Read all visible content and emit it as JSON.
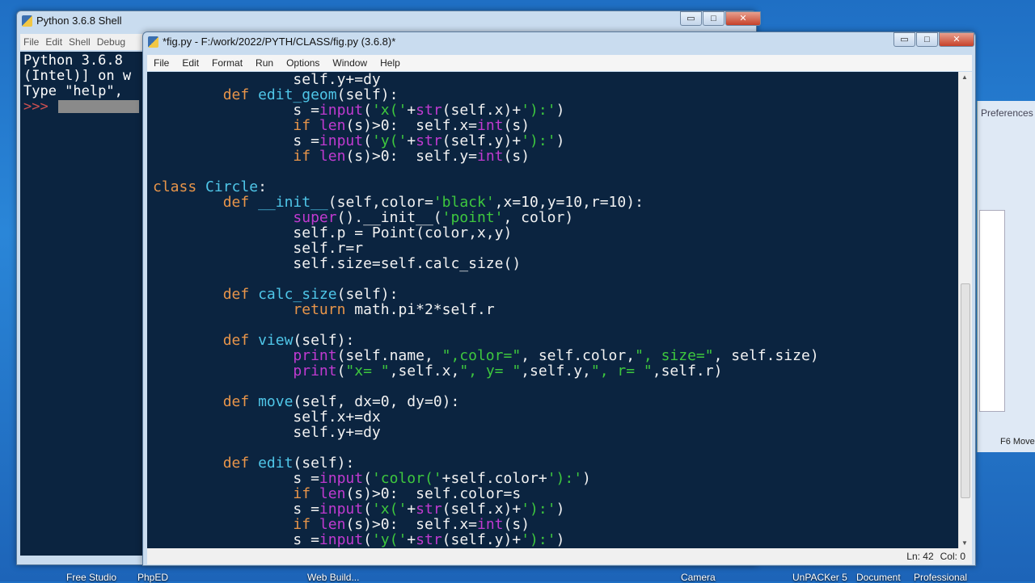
{
  "shell": {
    "title": "Python 3.6.8 Shell",
    "menu": [
      "File",
      "Edit",
      "Shell",
      "Debug"
    ],
    "lines": [
      "Python 3.6.8",
      "(Intel)] on w",
      "Type \"help\", "
    ],
    "prompt": ">>>"
  },
  "editor": {
    "title": "*fig.py - F:/work/2022/PYTH/CLASS/fig.py (3.6.8)*",
    "menu": [
      "File",
      "Edit",
      "Format",
      "Run",
      "Options",
      "Window",
      "Help"
    ],
    "status": {
      "line": "Ln: 42",
      "col": "Col: 0"
    },
    "code": [
      [
        [
          "",
          "                self.y+=dy"
        ]
      ],
      [
        [
          "",
          "        "
        ],
        [
          "k",
          "def"
        ],
        [
          "",
          " "
        ],
        [
          "d",
          "edit_geom"
        ],
        [
          "",
          "(self):"
        ]
      ],
      [
        [
          "",
          "                s ="
        ],
        [
          "b",
          "input"
        ],
        [
          "",
          "("
        ],
        [
          "s",
          "'x('"
        ],
        [
          "",
          "+"
        ],
        [
          "b",
          "str"
        ],
        [
          "",
          "(self.x)+"
        ],
        [
          "s",
          "'):'"
        ],
        [
          "",
          ")"
        ]
      ],
      [
        [
          "",
          "                "
        ],
        [
          "k",
          "if"
        ],
        [
          "",
          " "
        ],
        [
          "b",
          "len"
        ],
        [
          "",
          "(s)>0:  self.x="
        ],
        [
          "b",
          "int"
        ],
        [
          "",
          "(s)"
        ]
      ],
      [
        [
          "",
          "                s ="
        ],
        [
          "b",
          "input"
        ],
        [
          "",
          "("
        ],
        [
          "s",
          "'y('"
        ],
        [
          "",
          "+"
        ],
        [
          "b",
          "str"
        ],
        [
          "",
          "(self.y)+"
        ],
        [
          "s",
          "'):'"
        ],
        [
          "",
          ")"
        ]
      ],
      [
        [
          "",
          "                "
        ],
        [
          "k",
          "if"
        ],
        [
          "",
          " "
        ],
        [
          "b",
          "len"
        ],
        [
          "",
          "(s)>0:  self.y="
        ],
        [
          "b",
          "int"
        ],
        [
          "",
          "(s)"
        ]
      ],
      [],
      [
        [
          "k",
          "class"
        ],
        [
          "",
          " "
        ],
        [
          "d",
          "Circle"
        ],
        [
          "",
          ":"
        ]
      ],
      [
        [
          "",
          "        "
        ],
        [
          "k",
          "def"
        ],
        [
          "",
          " "
        ],
        [
          "d",
          "__init__"
        ],
        [
          "",
          "(self,color="
        ],
        [
          "s",
          "'black'"
        ],
        [
          "",
          ",x=10,y=10,r=10):"
        ]
      ],
      [
        [
          "",
          "                "
        ],
        [
          "b",
          "super"
        ],
        [
          "",
          "().__init__("
        ],
        [
          "s",
          "'point'"
        ],
        [
          "",
          ", color)"
        ]
      ],
      [
        [
          "",
          "                self.p = Point(color,x,y)"
        ]
      ],
      [
        [
          "",
          "                self.r=r"
        ]
      ],
      [
        [
          "",
          "                self.size=self.calc_size()"
        ]
      ],
      [],
      [
        [
          "",
          "        "
        ],
        [
          "k",
          "def"
        ],
        [
          "",
          " "
        ],
        [
          "d",
          "calc_size"
        ],
        [
          "",
          "(self):"
        ]
      ],
      [
        [
          "",
          "                "
        ],
        [
          "k",
          "return"
        ],
        [
          "",
          " math.pi*2*self.r"
        ]
      ],
      [],
      [
        [
          "",
          "        "
        ],
        [
          "k",
          "def"
        ],
        [
          "",
          " "
        ],
        [
          "d",
          "view"
        ],
        [
          "",
          "(self):"
        ]
      ],
      [
        [
          "",
          "                "
        ],
        [
          "b",
          "print"
        ],
        [
          "",
          "(self.name, "
        ],
        [
          "s",
          "\",color=\""
        ],
        [
          "",
          ", self.color,"
        ],
        [
          "s",
          "\", size=\""
        ],
        [
          "",
          ", self.size)"
        ]
      ],
      [
        [
          "",
          "                "
        ],
        [
          "b",
          "print"
        ],
        [
          "",
          "("
        ],
        [
          "s",
          "\"x= \""
        ],
        [
          "",
          ",self.x,"
        ],
        [
          "s",
          "\", y= \""
        ],
        [
          "",
          ",self.y,"
        ],
        [
          "s",
          "\", r= \""
        ],
        [
          "",
          ",self.r)"
        ]
      ],
      [],
      [
        [
          "",
          "        "
        ],
        [
          "k",
          "def"
        ],
        [
          "",
          " "
        ],
        [
          "d",
          "move"
        ],
        [
          "",
          "(self, dx=0, dy=0):"
        ]
      ],
      [
        [
          "",
          "                self.x+=dx"
        ]
      ],
      [
        [
          "",
          "                self.y+=dy"
        ]
      ],
      [],
      [
        [
          "",
          "        "
        ],
        [
          "k",
          "def"
        ],
        [
          "",
          " "
        ],
        [
          "d",
          "edit"
        ],
        [
          "",
          "(self):"
        ]
      ],
      [
        [
          "",
          "                s ="
        ],
        [
          "b",
          "input"
        ],
        [
          "",
          "("
        ],
        [
          "s",
          "'color('"
        ],
        [
          "",
          "+self.color+"
        ],
        [
          "s",
          "'):'"
        ],
        [
          "",
          ")"
        ]
      ],
      [
        [
          "",
          "                "
        ],
        [
          "k",
          "if"
        ],
        [
          "",
          " "
        ],
        [
          "b",
          "len"
        ],
        [
          "",
          "(s)>0:  self.color=s"
        ]
      ],
      [
        [
          "",
          "                s ="
        ],
        [
          "b",
          "input"
        ],
        [
          "",
          "("
        ],
        [
          "s",
          "'x('"
        ],
        [
          "",
          "+"
        ],
        [
          "b",
          "str"
        ],
        [
          "",
          "(self.x)+"
        ],
        [
          "s",
          "'):'"
        ],
        [
          "",
          ")"
        ]
      ],
      [
        [
          "",
          "                "
        ],
        [
          "k",
          "if"
        ],
        [
          "",
          " "
        ],
        [
          "b",
          "len"
        ],
        [
          "",
          "(s)>0:  self.x="
        ],
        [
          "b",
          "int"
        ],
        [
          "",
          "(s)"
        ]
      ],
      [
        [
          "",
          "                s ="
        ],
        [
          "b",
          "input"
        ],
        [
          "",
          "("
        ],
        [
          "s",
          "'y('"
        ],
        [
          "",
          "+"
        ],
        [
          "b",
          "str"
        ],
        [
          "",
          "(self.y)+"
        ],
        [
          "s",
          "'):'"
        ],
        [
          "",
          ")"
        ]
      ]
    ]
  },
  "right_window": {
    "preferences": "Preferences",
    "f6": "F6 Move"
  },
  "desktop_labels": [
    "Free Studio",
    "PhpED",
    "Web Build...",
    "Camera",
    "UnPACKer 5",
    "Document",
    "Professional"
  ]
}
